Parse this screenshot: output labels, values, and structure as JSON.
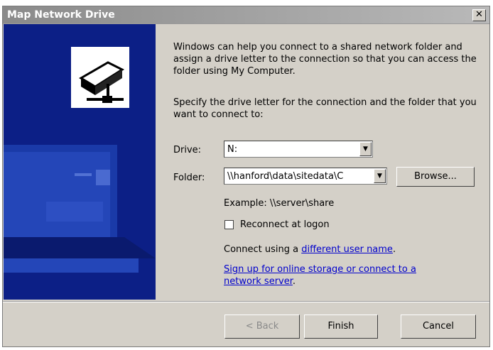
{
  "window": {
    "title": "Map Network Drive",
    "close_glyph": "✕"
  },
  "intro_text": "Windows can help you connect to a shared network folder and assign a drive letter to the connection so that you can access the folder using My Computer.",
  "instruction_text": "Specify the drive letter for the connection and the folder that you want to connect to:",
  "drive": {
    "label": "Drive:",
    "value": "N:"
  },
  "folder": {
    "label": "Folder:",
    "value": "\\\\hanford\\data\\sitedata\\C",
    "browse_label": "Browse..."
  },
  "example_text": "Example: \\\\server\\share",
  "reconnect": {
    "label": "Reconnect at logon",
    "checked": false
  },
  "connect_using": {
    "prefix": "Connect using a ",
    "link": "different user name",
    "suffix": "."
  },
  "signup": {
    "line1": "Sign up for online storage or connect to a",
    "line2": "network server",
    "suffix": "."
  },
  "buttons": {
    "back": "< Back",
    "finish": "Finish",
    "cancel": "Cancel"
  },
  "icons": {
    "illustration": "network-drive-icon",
    "dropdown": "chevron-down-icon"
  }
}
